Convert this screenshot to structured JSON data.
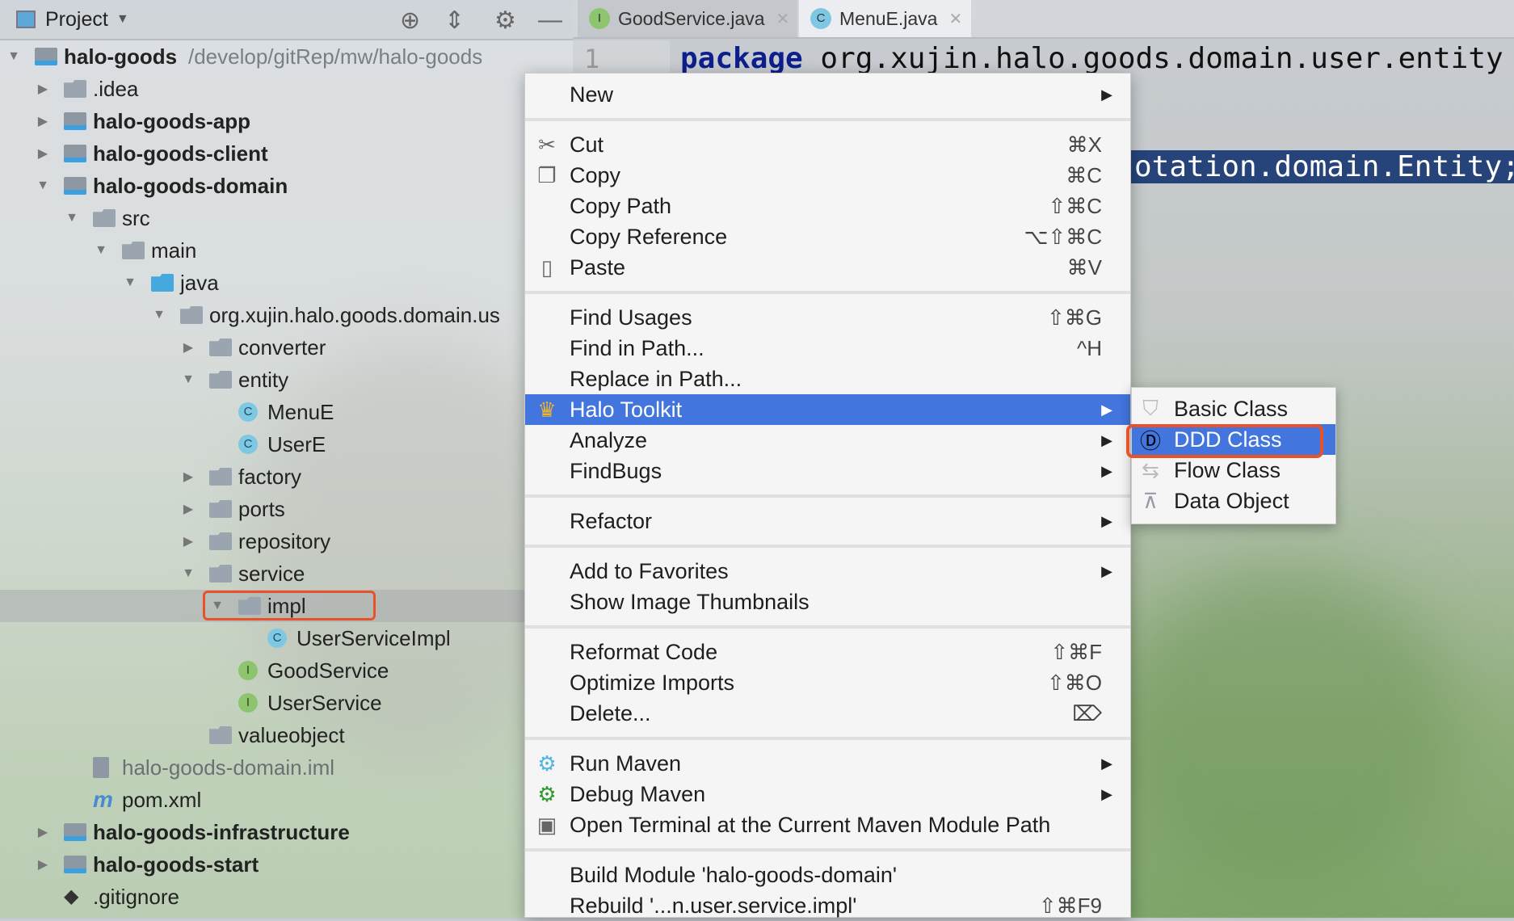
{
  "sidebar": {
    "title": "Project",
    "tree": [
      {
        "label": "halo-goods",
        "path": "/develop/gitRep/mw/halo-goods",
        "level": 0,
        "arrow": "expanded",
        "icon": "module",
        "bold": true
      },
      {
        "label": ".idea",
        "level": 1,
        "arrow": "collapsed",
        "icon": "folder"
      },
      {
        "label": "halo-goods-app",
        "level": 1,
        "arrow": "collapsed",
        "icon": "module",
        "bold": true
      },
      {
        "label": "halo-goods-client",
        "level": 1,
        "arrow": "collapsed",
        "icon": "module",
        "bold": true
      },
      {
        "label": "halo-goods-domain",
        "level": 1,
        "arrow": "expanded",
        "icon": "module",
        "bold": true
      },
      {
        "label": "src",
        "level": 2,
        "arrow": "expanded",
        "icon": "folder"
      },
      {
        "label": "main",
        "level": 3,
        "arrow": "expanded",
        "icon": "folder"
      },
      {
        "label": "java",
        "level": 4,
        "arrow": "expanded",
        "icon": "source-folder"
      },
      {
        "label": "org.xujin.halo.goods.domain.us",
        "level": 5,
        "arrow": "expanded",
        "icon": "package"
      },
      {
        "label": "converter",
        "level": 6,
        "arrow": "collapsed",
        "icon": "package"
      },
      {
        "label": "entity",
        "level": 6,
        "arrow": "expanded",
        "icon": "package"
      },
      {
        "label": "MenuE",
        "level": 7,
        "icon": "class"
      },
      {
        "label": "UserE",
        "level": 7,
        "icon": "class"
      },
      {
        "label": "factory",
        "level": 6,
        "arrow": "collapsed",
        "icon": "package"
      },
      {
        "label": "ports",
        "level": 6,
        "arrow": "collapsed",
        "icon": "package"
      },
      {
        "label": "repository",
        "level": 6,
        "arrow": "collapsed",
        "icon": "package"
      },
      {
        "label": "service",
        "level": 6,
        "arrow": "expanded",
        "icon": "package"
      },
      {
        "label": "impl",
        "level": 7,
        "arrow": "expanded",
        "icon": "package",
        "selected": true
      },
      {
        "label": "UserServiceImpl",
        "level": 8,
        "icon": "class"
      },
      {
        "label": "GoodService",
        "level": 7,
        "icon": "interface"
      },
      {
        "label": "UserService",
        "level": 7,
        "icon": "interface"
      },
      {
        "label": "valueobject",
        "level": 6,
        "icon": "package"
      },
      {
        "label": "halo-goods-domain.iml",
        "level": 2,
        "icon": "iml",
        "muted": true
      },
      {
        "label": "pom.xml",
        "level": 2,
        "icon": "maven"
      },
      {
        "label": "halo-goods-infrastructure",
        "level": 1,
        "arrow": "collapsed",
        "icon": "module",
        "bold": true
      },
      {
        "label": "halo-goods-start",
        "level": 1,
        "arrow": "collapsed",
        "icon": "module",
        "bold": true
      },
      {
        "label": ".gitignore",
        "level": 1,
        "icon": "gitignore"
      }
    ]
  },
  "tabs": [
    {
      "label": "GoodService.java",
      "badge": "I",
      "active": false
    },
    {
      "label": "MenuE.java",
      "badge": "C",
      "active": true
    }
  ],
  "editor": {
    "line_number": "1",
    "keyword": "package",
    "line1": " org.xujin.halo.goods.domain.user.entity",
    "selected_fragment": "otation.domain.Entity;"
  },
  "menu": {
    "items": [
      {
        "label": "New",
        "submenu": true
      },
      {
        "sep": true
      },
      {
        "label": "Cut",
        "shortcut": "⌘X",
        "icon": "scissors-icon"
      },
      {
        "label": "Copy",
        "shortcut": "⌘C",
        "icon": "copy-icon"
      },
      {
        "label": "Copy Path",
        "shortcut": "⇧⌘C"
      },
      {
        "label": "Copy Reference",
        "shortcut": "⌥⇧⌘C"
      },
      {
        "label": "Paste",
        "shortcut": "⌘V",
        "icon": "clipboard-icon"
      },
      {
        "sep": true
      },
      {
        "label": "Find Usages",
        "shortcut": "⇧⌘G"
      },
      {
        "label": "Find in Path...",
        "shortcut": "^H"
      },
      {
        "label": "Replace in Path..."
      },
      {
        "label": "Halo Toolkit",
        "submenu": true,
        "icon": "crown-icon",
        "highlighted": true
      },
      {
        "label": "Analyze",
        "submenu": true
      },
      {
        "label": "FindBugs",
        "submenu": true
      },
      {
        "sep": true
      },
      {
        "label": "Refactor",
        "submenu": true
      },
      {
        "sep": true
      },
      {
        "label": "Add to Favorites",
        "submenu": true
      },
      {
        "label": "Show Image Thumbnails"
      },
      {
        "sep": true
      },
      {
        "label": "Reformat Code",
        "shortcut": "⇧⌘F"
      },
      {
        "label": "Optimize Imports",
        "shortcut": "⇧⌘O"
      },
      {
        "label": "Delete...",
        "shortcut": "⌦"
      },
      {
        "sep": true
      },
      {
        "label": "Run Maven",
        "submenu": true,
        "icon": "run-maven-gear-icon"
      },
      {
        "label": "Debug Maven",
        "submenu": true,
        "icon": "debug-maven-gear-icon"
      },
      {
        "label": "Open Terminal at the Current Maven Module Path",
        "icon": "terminal-icon"
      },
      {
        "sep": true
      },
      {
        "label": "Build Module 'halo-goods-domain'"
      },
      {
        "label": "Rebuild '...n.user.service.impl'",
        "shortcut": "⇧⌘F9"
      }
    ]
  },
  "submenu": {
    "items": [
      {
        "label": "Basic Class",
        "icon": "badge-icon"
      },
      {
        "label": "DDD Class",
        "icon": "ddd-icon",
        "highlighted": true
      },
      {
        "label": "Flow Class",
        "icon": "flow-icon"
      },
      {
        "label": "Data Object",
        "icon": "hierarchy-icon"
      }
    ]
  },
  "colors": {
    "highlight": "#4375de",
    "annotation": "#e8522a",
    "keyword": "#0c1f8c"
  }
}
